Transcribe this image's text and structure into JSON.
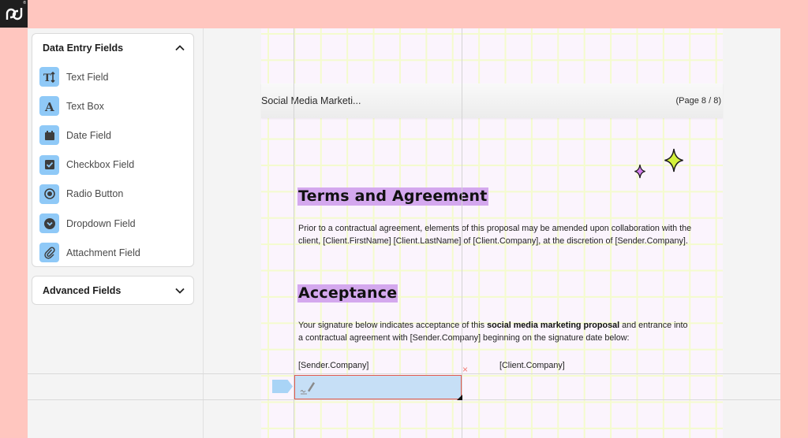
{
  "brand": {
    "logo_text": "pd",
    "registered": "®"
  },
  "sidebar": {
    "data_entry": {
      "title": "Data Entry Fields",
      "expanded": true,
      "items": [
        {
          "label": "Text Field",
          "icon": "text-field-icon"
        },
        {
          "label": "Text Box",
          "icon": "text-box-icon"
        },
        {
          "label": "Date Field",
          "icon": "calendar-icon"
        },
        {
          "label": "Checkbox Field",
          "icon": "checkbox-icon"
        },
        {
          "label": "Radio Button",
          "icon": "radio-icon"
        },
        {
          "label": "Dropdown Field",
          "icon": "dropdown-icon"
        },
        {
          "label": "Attachment Field",
          "icon": "paperclip-icon"
        }
      ]
    },
    "advanced": {
      "title": "Advanced Fields",
      "expanded": false
    }
  },
  "document": {
    "header": {
      "title": "Social Media Marketi...",
      "page_indicator": "(Page 8 / 8)"
    },
    "sections": {
      "terms": {
        "heading": "Terms and Agreement",
        "paragraph": "Prior to a contractual agreement, elements of this proposal may be amended upon collaboration with the client, [Client.FirstName] [Client.LastName] of [Client.Company], at the discretion of [Sender.Company]."
      },
      "acceptance": {
        "heading": "Acceptance",
        "paragraph_before": "Your signature below indicates acceptance of this ",
        "paragraph_bold": "social media marketing proposal",
        "paragraph_after": " and entrance into a contractual agreement with [Sender.Company] beginning on the signature date below:"
      }
    },
    "signatures": {
      "sender_label": "[Sender.Company]",
      "client_label": "[Client.Company]",
      "signature_field": {
        "icon": "signature-icon",
        "remove_label": "×"
      }
    }
  },
  "colors": {
    "background": "#ffc6bf",
    "field_icon_bg": "#8fc9f7",
    "heading_highlight": "#d4a8ee",
    "signature_field_bg": "#c6dff6",
    "signature_border": "#e15b4e",
    "sparkle_lime": "#d4f13c",
    "sparkle_purple": "#d47ef0"
  }
}
